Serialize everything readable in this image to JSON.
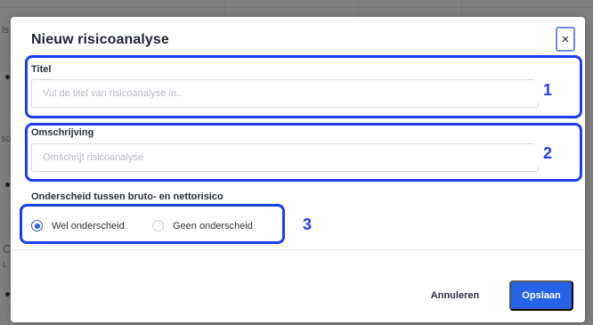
{
  "background": {
    "fragments": [
      "ls",
      "so",
      "C",
      "L"
    ]
  },
  "modal": {
    "title": "Nieuw risicoanalyse",
    "close_label": "×",
    "title_field": {
      "label": "Titel",
      "value": "",
      "placeholder": "Vul de titel van risicoanalyse in.."
    },
    "description_field": {
      "label": "Omschrijving",
      "value": "",
      "placeholder": "Omschrijf risicoanalyse"
    },
    "distinction": {
      "label": "Onderscheid tussen bruto- en nettorisico",
      "options": [
        {
          "label": "Wel onderscheid",
          "checked": true
        },
        {
          "label": "Geen onderscheid",
          "checked": false
        }
      ]
    },
    "footer": {
      "cancel_label": "Annuleren",
      "save_label": "Opslaan"
    }
  },
  "annotations": {
    "color": "#1a3ff0",
    "labels": [
      "1",
      "2",
      "3"
    ]
  },
  "colors": {
    "primary": "#2663e8",
    "radio_selected": "#2f5fe0",
    "overlay": "#808080"
  }
}
